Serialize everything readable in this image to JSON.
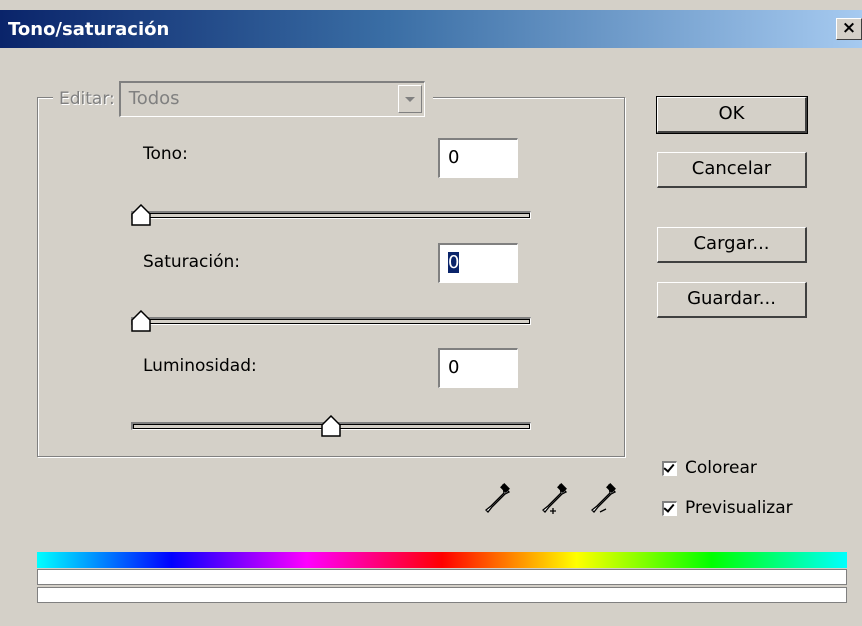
{
  "window": {
    "title": "Tono/saturación",
    "close_glyph": "×"
  },
  "edit": {
    "label": "Editar:",
    "value": "Todos"
  },
  "fields": {
    "tono": {
      "label": "Tono:",
      "value": "0",
      "slider_fraction": 0.0
    },
    "saturacion": {
      "label": "Saturación:",
      "value": "0",
      "slider_fraction": 0.0
    },
    "luminosidad": {
      "label": "Luminosidad:",
      "value": "0",
      "slider_fraction": 0.5
    }
  },
  "buttons": {
    "ok": "OK",
    "cancel": "Cancelar",
    "load": "Cargar...",
    "save": "Guardar..."
  },
  "checkboxes": {
    "colorize": {
      "label": "Colorear",
      "checked": true
    },
    "preview": {
      "label": "Previsualizar",
      "checked": true
    }
  },
  "icons": [
    "eyedropper-icon",
    "eyedropper-plus-icon",
    "eyedropper-minus-icon"
  ],
  "colors": {
    "title_start": "#0a246a",
    "title_end": "#a6caf0",
    "face": "#d4d0c8"
  }
}
